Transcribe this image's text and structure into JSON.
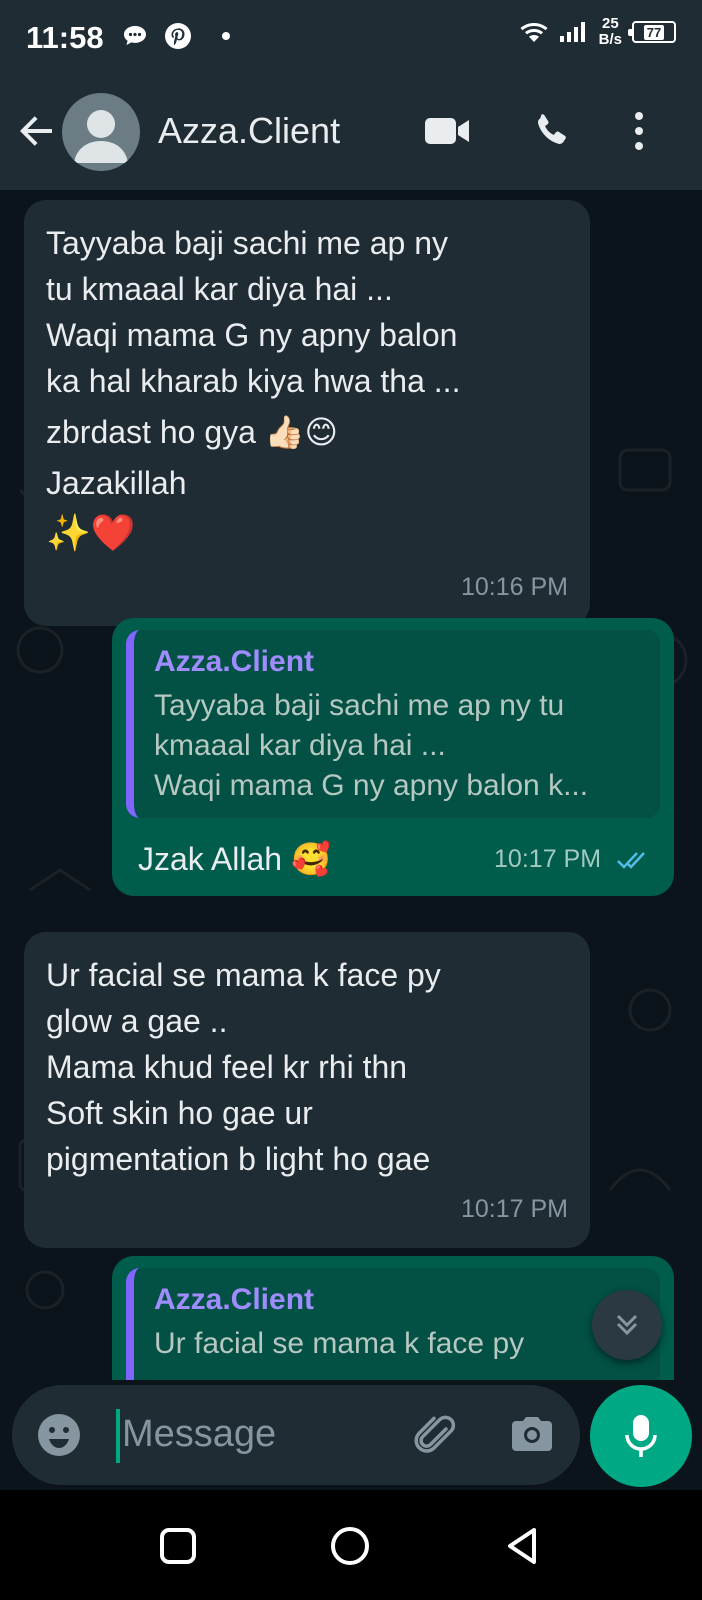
{
  "status_bar": {
    "time": "11:58",
    "net_speed_value": "25",
    "net_speed_unit": "B/s",
    "battery": "77"
  },
  "header": {
    "contact_name": "Azza.Client"
  },
  "messages": [
    {
      "direction": "incoming",
      "lines": [
        "Tayyaba baji sachi me ap ny",
        "tu kmaaal kar diya hai ...",
        "Waqi mama G ny apny balon",
        "ka hal kharab kiya hwa tha ...",
        "zbrdast ho gya 👍🏻😊",
        "Jazakillah",
        "✨❤️"
      ],
      "time": "10:16 PM"
    },
    {
      "direction": "outgoing",
      "quote_author": "Azza.Client",
      "quote_lines": [
        "Tayyaba baji sachi me ap ny tu",
        "kmaaal kar diya hai ...",
        "Waqi mama G ny apny balon k..."
      ],
      "text": "Jzak Allah 🥰",
      "time": "10:17 PM"
    },
    {
      "direction": "incoming",
      "lines": [
        "Ur facial se mama k face py",
        "glow a gae ..",
        "Mama khud feel kr rhi thn",
        "Soft skin ho gae ur",
        "pigmentation b light ho gae"
      ],
      "time": "10:17 PM"
    },
    {
      "direction": "outgoing",
      "quote_author": "Azza.Client",
      "quote_partial": "Ur facial se mama k face py"
    }
  ],
  "input": {
    "placeholder": "Message"
  },
  "colors": {
    "accent": "#00a884",
    "outgoing_bubble": "#005c4b",
    "incoming_bubble": "#202c33",
    "chat_bg": "#0b141a",
    "header_bg": "#1f2c34"
  }
}
